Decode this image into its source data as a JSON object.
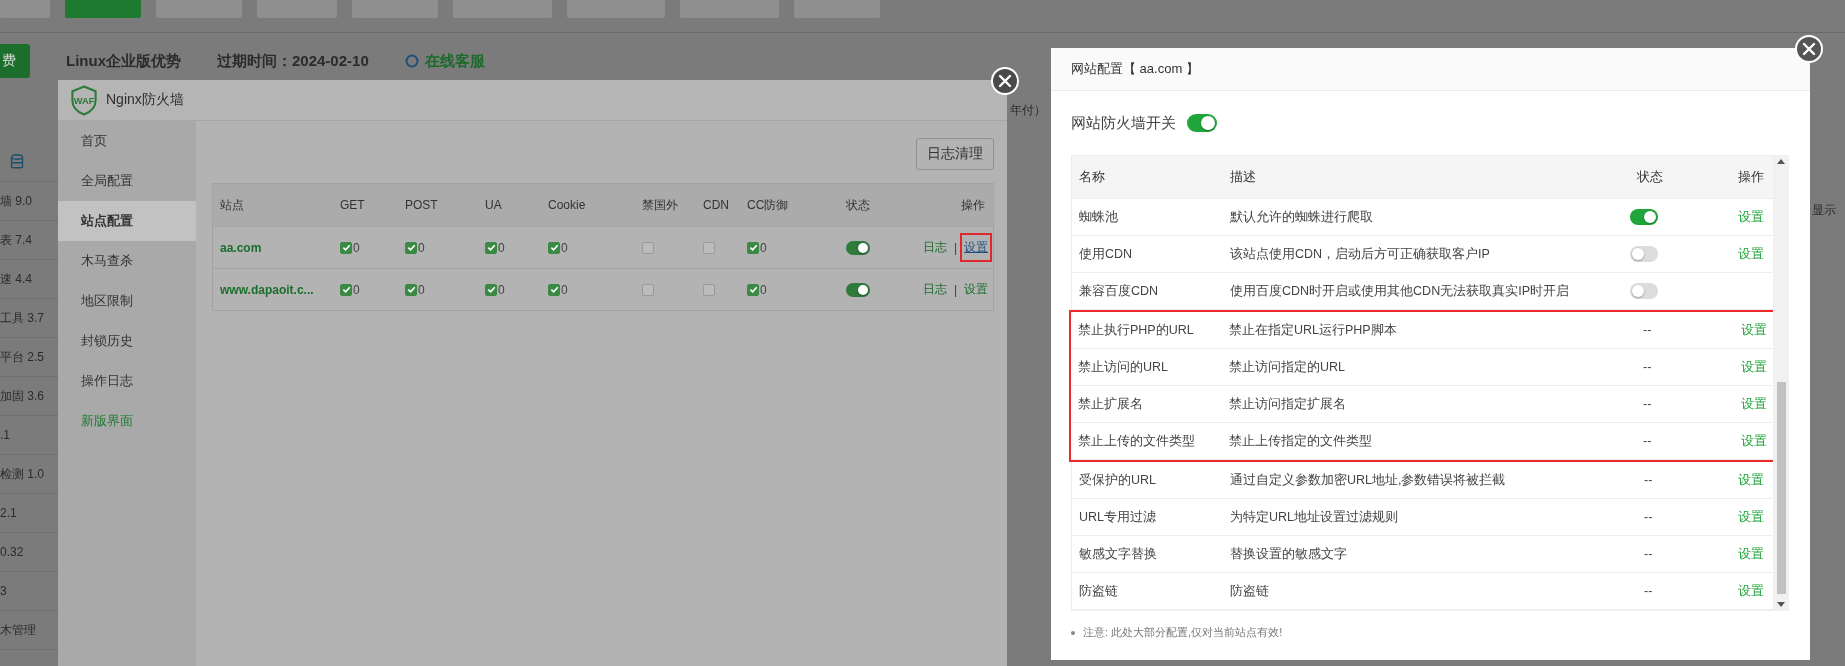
{
  "background": {
    "top_buttons": [
      {
        "selected": false
      },
      {
        "selected": true
      },
      {
        "selected": false
      },
      {
        "selected": false
      },
      {
        "selected": false
      },
      {
        "selected": false
      },
      {
        "selected": false
      },
      {
        "selected": false
      },
      {
        "selected": false
      }
    ],
    "promo": {
      "badge": "费",
      "title": "Linux企业版优势",
      "expiry": "过期时间：2024-02-10",
      "support": "在线客服"
    },
    "side_items": [
      "墙 9.0",
      "表 7.4",
      "速 4.4",
      "工具 3.7",
      "平台 2.5",
      "加固 3.6",
      ".1",
      "检测 1.0",
      "2.1",
      "0.32",
      "3",
      "木管理"
    ],
    "notes": [
      "年付）",
      "显示"
    ]
  },
  "firewall": {
    "title": "Nginx防火墙",
    "icon_text": "WAF",
    "sidebar": [
      {
        "label": "首页",
        "selected": false,
        "kind": "menu"
      },
      {
        "label": "全局配置",
        "selected": false,
        "kind": "menu"
      },
      {
        "label": "站点配置",
        "selected": true,
        "kind": "menu"
      },
      {
        "label": "木马查杀",
        "selected": false,
        "kind": "menu"
      },
      {
        "label": "地区限制",
        "selected": false,
        "kind": "menu"
      },
      {
        "label": "封锁历史",
        "selected": false,
        "kind": "menu"
      },
      {
        "label": "操作日志",
        "selected": false,
        "kind": "menu"
      },
      {
        "label": "新版界面",
        "selected": false,
        "kind": "link"
      }
    ],
    "clear_button": "日志清理",
    "table": {
      "columns": [
        "站点",
        "GET",
        "POST",
        "UA",
        "Cookie",
        "禁国外",
        "CDN",
        "CC防御",
        "状态",
        "操作"
      ],
      "rows": [
        {
          "site": "aa.com",
          "checks": [
            {
              "checked": true,
              "count": "0"
            },
            {
              "checked": true,
              "count": "0"
            },
            {
              "checked": true,
              "count": "0"
            },
            {
              "checked": true,
              "count": "0"
            },
            {
              "checked": false
            },
            {
              "checked": false
            },
            {
              "checked": true,
              "count": "0"
            }
          ],
          "status_on": true,
          "separator": "|",
          "actions": [
            {
              "label": "日志",
              "highlighted": false
            },
            {
              "label": "设置",
              "highlighted": true
            }
          ]
        },
        {
          "site": "www.dapaoit.c...",
          "checks": [
            {
              "checked": true,
              "count": "0"
            },
            {
              "checked": true,
              "count": "0"
            },
            {
              "checked": true,
              "count": "0"
            },
            {
              "checked": true,
              "count": "0"
            },
            {
              "checked": false
            },
            {
              "checked": false
            },
            {
              "checked": true,
              "count": "0"
            }
          ],
          "status_on": true,
          "separator": "|",
          "actions": [
            {
              "label": "日志",
              "highlighted": false
            },
            {
              "label": "设置",
              "highlighted": false
            }
          ]
        }
      ]
    }
  },
  "site_config": {
    "title": "网站配置【 aa.com 】",
    "switch_label": "网站防火墙开关",
    "switch_on": true,
    "columns": [
      "名称",
      "描述",
      "状态",
      "操作"
    ],
    "rows": [
      {
        "name": "蜘蛛池",
        "desc": "默认允许的蜘蛛进行爬取",
        "status": {
          "kind": "toggle",
          "on": true
        },
        "action": "设置",
        "highlighted": false
      },
      {
        "name": "使用CDN",
        "desc": "该站点使用CDN，启动后方可正确获取客户IP",
        "status": {
          "kind": "toggle",
          "on": false
        },
        "action": "设置",
        "highlighted": false
      },
      {
        "name": "兼容百度CDN",
        "desc": "使用百度CDN时开启或使用其他CDN无法获取真实IP时开启",
        "status": {
          "kind": "toggle",
          "on": false
        },
        "highlighted": false
      },
      {
        "name": "禁止执行PHP的URL",
        "desc": "禁止在指定URL运行PHP脚本",
        "status": {
          "kind": "text",
          "text": "--"
        },
        "action": "设置",
        "highlighted": true
      },
      {
        "name": "禁止访问的URL",
        "desc": "禁止访问指定的URL",
        "status": {
          "kind": "text",
          "text": "--"
        },
        "action": "设置",
        "highlighted": true
      },
      {
        "name": "禁止扩展名",
        "desc": "禁止访问指定扩展名",
        "status": {
          "kind": "text",
          "text": "--"
        },
        "action": "设置",
        "highlighted": true
      },
      {
        "name": "禁止上传的文件类型",
        "desc": "禁止上传指定的文件类型",
        "status": {
          "kind": "text",
          "text": "--"
        },
        "action": "设置",
        "highlighted": true
      },
      {
        "name": "受保护的URL",
        "desc": "通过自定义参数加密URL地址,参数错误将被拦截",
        "status": {
          "kind": "text",
          "text": "--"
        },
        "action": "设置",
        "highlighted": false
      },
      {
        "name": "URL专用过滤",
        "desc": "为特定URL地址设置过滤规则",
        "status": {
          "kind": "text",
          "text": "--"
        },
        "action": "设置",
        "highlighted": false
      },
      {
        "name": "敏感文字替换",
        "desc": "替换设置的敏感文字",
        "status": {
          "kind": "text",
          "text": "--"
        },
        "action": "设置",
        "highlighted": false
      },
      {
        "name": "防盗链",
        "desc": "防盗链",
        "status": {
          "kind": "text",
          "text": "--"
        },
        "action": "设置",
        "highlighted": false
      }
    ],
    "note": "注意: 此处大部分配置,仅对当前站点有效!"
  }
}
